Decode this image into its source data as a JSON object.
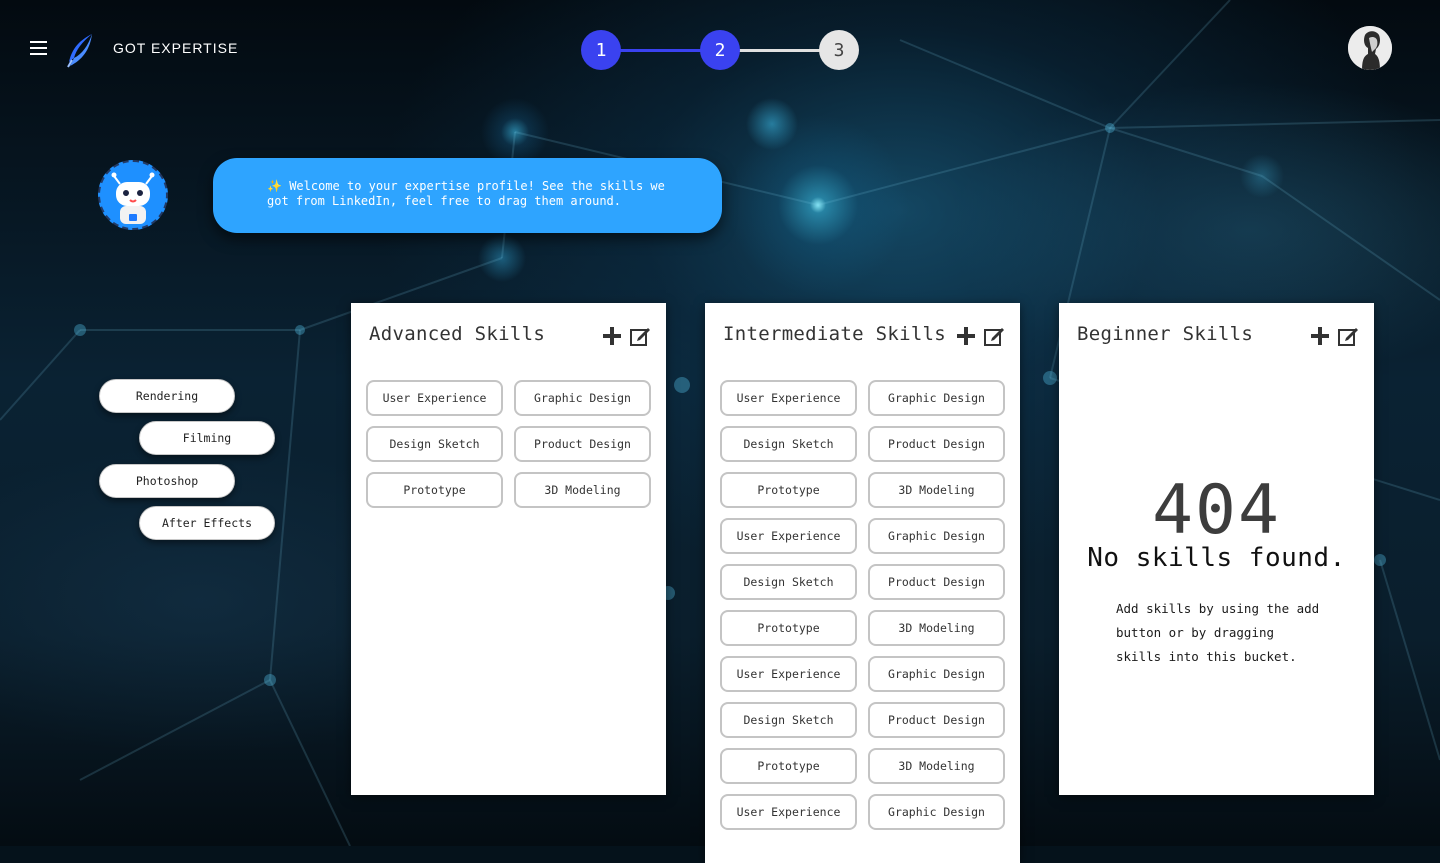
{
  "header": {
    "brand": "GOT EXPERTISE",
    "menu_icon": "hamburger-menu-icon",
    "logo_icon": "feather-logo-icon",
    "avatar_icon": "user-avatar"
  },
  "stepper": {
    "steps": [
      {
        "label": "1",
        "state": "complete"
      },
      {
        "label": "2",
        "state": "current"
      },
      {
        "label": "3",
        "state": "pending"
      }
    ],
    "active_color": "#3a42f0",
    "pending_color": "#e6e6e6"
  },
  "assistant": {
    "icon": "robot-icon",
    "message_icon": "sparkle-icon",
    "message": "Welcome to your expertise profile! See the skills we got from LinkedIn, feel free to drag them around."
  },
  "unsorted_skills": [
    "Rendering",
    "Filming",
    "Photoshop",
    "After Effects"
  ],
  "buckets": [
    {
      "title": "Advanced Skills",
      "skills": [
        "User Experience",
        "Graphic Design",
        "Design Sketch",
        "Product Design",
        "Prototype",
        "3D Modeling"
      ]
    },
    {
      "title": "Intermediate Skills",
      "skills": [
        "User Experience",
        "Graphic Design",
        "Design Sketch",
        "Product Design",
        "Prototype",
        "3D Modeling",
        "User Experience",
        "Graphic Design",
        "Design Sketch",
        "Product Design",
        "Prototype",
        "3D Modeling",
        "User Experience",
        "Graphic Design",
        "Design Sketch",
        "Product Design",
        "Prototype",
        "3D Modeling",
        "User Experience",
        "Graphic Design"
      ]
    },
    {
      "title": "Beginner Skills",
      "skills": [],
      "empty_code": "404",
      "empty_title": "No skills found.",
      "empty_hint": "Add skills by using the add button or by dragging skills into this bucket."
    }
  ],
  "colors": {
    "bubble": "#2ea4ff",
    "bot": "#1e90ff"
  }
}
